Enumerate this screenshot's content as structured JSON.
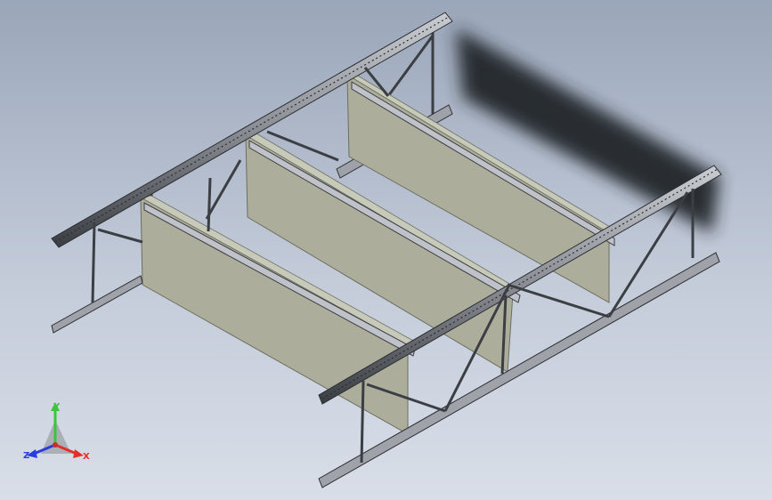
{
  "app": {
    "title": ""
  },
  "triad": {
    "axis_x": "X",
    "axis_y": "Y",
    "axis_z": "Z",
    "color_x": "#e0302a",
    "color_y": "#3cc43c",
    "color_z": "#2a3ee0"
  },
  "colors": {
    "background_top": "#9aa6b9",
    "background_bottom": "#d9dee8",
    "panel_fill": "#acae9b",
    "panel_edge": "#6c6e60",
    "steel": "#8d9197",
    "steel_dark": "#2f3236",
    "shadow": "#2a2d31"
  }
}
